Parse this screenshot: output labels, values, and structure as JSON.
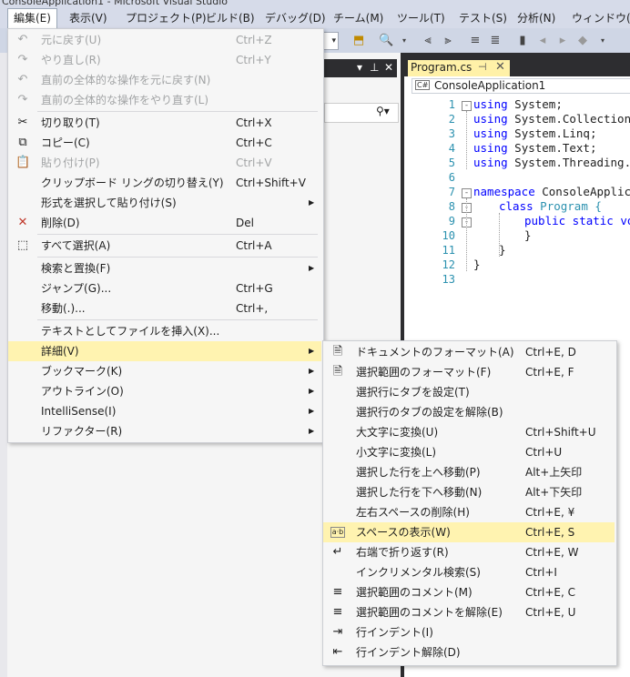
{
  "title": {
    "text": "ConsoleApplication1 - Microsoft Visual Studio"
  },
  "menubar": [
    {
      "label": "編集(E)",
      "active": true
    },
    {
      "label": "表示(V)"
    },
    {
      "label": "プロジェクト(P)"
    },
    {
      "label": "ビルド(B)"
    },
    {
      "label": "デバッグ(D)"
    },
    {
      "label": "チーム(M)"
    },
    {
      "label": "ツール(T)"
    },
    {
      "label": "テスト(S)"
    },
    {
      "label": "分析(N)"
    },
    {
      "label": "ウィンドウ(W)"
    }
  ],
  "editor": {
    "tab_label": "Program.cs",
    "nav_combo": "ConsoleApplication1",
    "line_numbers": [
      "1",
      "2",
      "3",
      "4",
      "5",
      "6",
      "7",
      "8",
      "9",
      "10",
      "11",
      "12",
      "13"
    ],
    "code": [
      {
        "kw": "using",
        "rest": " System;"
      },
      {
        "kw": "using",
        "rest": " System.Collections."
      },
      {
        "kw": "using",
        "rest": " System.Linq;"
      },
      {
        "kw": "using",
        "rest": " System.Text;"
      },
      {
        "kw": "using",
        "rest": " System.Threading.Ta"
      },
      {
        "kw": "",
        "rest": ""
      },
      {
        "kw": "namespace",
        "rest": " ConsoleApplicat"
      },
      {
        "kw": "class",
        "rest": " Program {",
        "type": "Program"
      },
      {
        "kw": "public static voi",
        "rest": ""
      },
      {
        "kw": "",
        "rest": "}"
      },
      {
        "kw": "",
        "rest": "}"
      },
      {
        "kw": "",
        "rest": "}"
      },
      {
        "kw": "",
        "rest": ""
      }
    ]
  },
  "edit_menu": {
    "items": [
      {
        "label": "元に戻す(U)",
        "shortcut": "Ctrl+Z",
        "icon": "undo-icon",
        "glyph": "↶",
        "disabled": true
      },
      {
        "label": "やり直し(R)",
        "shortcut": "Ctrl+Y",
        "icon": "redo-icon",
        "glyph": "↷",
        "disabled": true
      },
      {
        "label": "直前の全体的な操作を元に戻す(N)",
        "shortcut": "",
        "icon": "undo-global-icon",
        "glyph": "↶",
        "disabled": true
      },
      {
        "label": "直前の全体的な操作をやり直す(L)",
        "shortcut": "",
        "icon": "redo-global-icon",
        "glyph": "↷",
        "disabled": true,
        "sep_after": true
      },
      {
        "label": "切り取り(T)",
        "shortcut": "Ctrl+X",
        "icon": "scissors-icon",
        "glyph": "✂"
      },
      {
        "label": "コピー(C)",
        "shortcut": "Ctrl+C",
        "icon": "copy-icon",
        "glyph": "⧉"
      },
      {
        "label": "貼り付け(P)",
        "shortcut": "Ctrl+V",
        "icon": "paste-icon",
        "glyph": "📋",
        "disabled": true
      },
      {
        "label": "クリップボード リングの切り替え(Y)",
        "shortcut": "Ctrl+Shift+V",
        "icon": "",
        "glyph": ""
      },
      {
        "label": "形式を選択して貼り付け(S)",
        "shortcut": "",
        "submenu": true,
        "icon": "",
        "glyph": ""
      },
      {
        "label": "削除(D)",
        "shortcut": "Del",
        "icon": "delete-x-icon",
        "glyph": "✕",
        "sep_after": true
      },
      {
        "label": "すべて選択(A)",
        "shortcut": "Ctrl+A",
        "icon": "select-all-icon",
        "glyph": "⬚",
        "sep_after": true
      },
      {
        "label": "検索と置換(F)",
        "shortcut": "",
        "submenu": true,
        "icon": "",
        "glyph": ""
      },
      {
        "label": "ジャンプ(G)...",
        "shortcut": "Ctrl+G",
        "icon": "",
        "glyph": ""
      },
      {
        "label": "移動(.)...",
        "shortcut": "Ctrl+,",
        "icon": "",
        "glyph": "",
        "sep_after": true
      },
      {
        "label": "テキストとしてファイルを挿入(X)...",
        "shortcut": "",
        "icon": "",
        "glyph": ""
      },
      {
        "label": "詳細(V)",
        "shortcut": "",
        "submenu": true,
        "highlight": true,
        "icon": "",
        "glyph": ""
      },
      {
        "label": "ブックマーク(K)",
        "shortcut": "",
        "submenu": true,
        "icon": "",
        "glyph": ""
      },
      {
        "label": "アウトライン(O)",
        "shortcut": "",
        "submenu": true,
        "icon": "",
        "glyph": ""
      },
      {
        "label": "IntelliSense(I)",
        "shortcut": "",
        "submenu": true,
        "icon": "",
        "glyph": ""
      },
      {
        "label": "リファクター(R)",
        "shortcut": "",
        "submenu": true,
        "icon": "",
        "glyph": ""
      }
    ]
  },
  "advanced_menu": {
    "items": [
      {
        "label": "ドキュメントのフォーマット(A)",
        "shortcut": "Ctrl+E, D",
        "icon": "format-document-icon",
        "glyph": "🗎"
      },
      {
        "label": "選択範囲のフォーマット(F)",
        "shortcut": "Ctrl+E, F",
        "icon": "format-selection-icon",
        "glyph": "🗎"
      },
      {
        "label": "選択行にタブを設定(T)",
        "shortcut": "",
        "icon": "",
        "glyph": ""
      },
      {
        "label": "選択行のタブの設定を解除(B)",
        "shortcut": "",
        "icon": "",
        "glyph": ""
      },
      {
        "label": "大文字に変換(U)",
        "shortcut": "Ctrl+Shift+U",
        "icon": "",
        "glyph": ""
      },
      {
        "label": "小文字に変換(L)",
        "shortcut": "Ctrl+U",
        "icon": "",
        "glyph": ""
      },
      {
        "label": "選択した行を上へ移動(P)",
        "shortcut": "Alt+上矢印",
        "icon": "",
        "glyph": ""
      },
      {
        "label": "選択した行を下へ移動(N)",
        "shortcut": "Alt+下矢印",
        "icon": "",
        "glyph": ""
      },
      {
        "label": "左右スペースの削除(H)",
        "shortcut": "Ctrl+E, ¥",
        "icon": "",
        "glyph": ""
      },
      {
        "label": "スペースの表示(W)",
        "shortcut": "Ctrl+E, S",
        "icon": "view-whitespace-icon",
        "glyph": "a·b",
        "highlight": true
      },
      {
        "label": "右端で折り返す(R)",
        "shortcut": "Ctrl+E, W",
        "icon": "word-wrap-icon",
        "glyph": "↵"
      },
      {
        "label": "インクリメンタル検索(S)",
        "shortcut": "Ctrl+I",
        "icon": "",
        "glyph": ""
      },
      {
        "label": "選択範囲のコメント(M)",
        "shortcut": "Ctrl+E, C",
        "icon": "comment-icon",
        "glyph": "≡"
      },
      {
        "label": "選択範囲のコメントを解除(E)",
        "shortcut": "Ctrl+E, U",
        "icon": "uncomment-icon",
        "glyph": "≡"
      },
      {
        "label": "行インデント(I)",
        "shortcut": "",
        "icon": "indent-icon",
        "glyph": "⇥"
      },
      {
        "label": "行インデント解除(D)",
        "shortcut": "",
        "icon": "outdent-icon",
        "glyph": "⇤"
      }
    ]
  },
  "colors": {
    "highlight": "#fff3b0",
    "menu_bg": "#f6f6f6",
    "disabled": "#a2a4a5",
    "keyword": "#0000ff",
    "type": "#2b91af"
  }
}
